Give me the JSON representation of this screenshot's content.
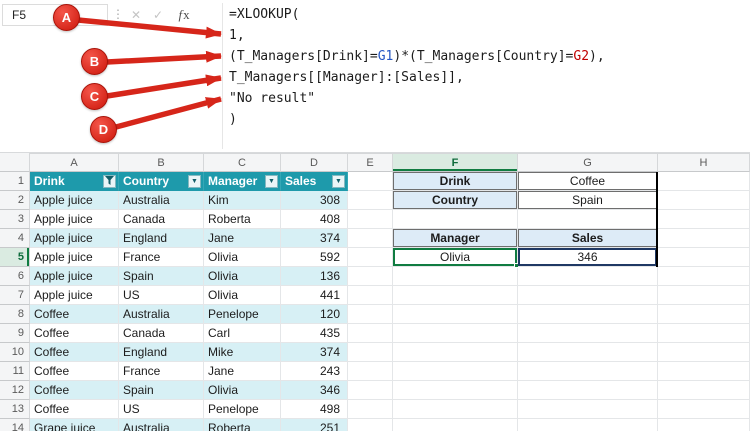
{
  "name_box": {
    "value": "F5"
  },
  "formula_bar": {
    "cancel": "✕",
    "enter": "✓",
    "fx": "fx",
    "lines": [
      [
        {
          "t": "=XLOOKUP(",
          "c": "d"
        }
      ],
      [
        {
          "t": "1,",
          "c": "d"
        }
      ],
      [
        {
          "t": "(T_Managers[Drink]=",
          "c": "d"
        },
        {
          "t": "G1",
          "c": "r1"
        },
        {
          "t": ")*(T_Managers[Country]=",
          "c": "d"
        },
        {
          "t": "G2",
          "c": "r2"
        },
        {
          "t": "),",
          "c": "d"
        }
      ],
      [
        {
          "t": "T_Managers[[Manager]:[Sales]],",
          "c": "d"
        }
      ],
      [
        {
          "t": "\"No result\"",
          "c": "d"
        }
      ],
      [
        {
          "t": ")",
          "c": "d"
        }
      ]
    ]
  },
  "callouts": [
    {
      "label": "A"
    },
    {
      "label": "B"
    },
    {
      "label": "C"
    },
    {
      "label": "D"
    }
  ],
  "grid": {
    "columns": [
      "A",
      "B",
      "C",
      "D",
      "E",
      "F",
      "G",
      "H"
    ],
    "rows": [
      "1",
      "2",
      "3",
      "4",
      "5",
      "6",
      "7",
      "8",
      "9",
      "10",
      "11",
      "12",
      "13",
      "14"
    ]
  },
  "table": {
    "name": "T_Managers",
    "headers": [
      {
        "label": "Drink",
        "filtered": true
      },
      {
        "label": "Country",
        "filtered": false
      },
      {
        "label": "Manager",
        "filtered": false
      },
      {
        "label": "Sales",
        "filtered": false
      }
    ],
    "rows": [
      [
        "Apple juice",
        "Australia",
        "Kim",
        "308"
      ],
      [
        "Apple juice",
        "Canada",
        "Roberta",
        "408"
      ],
      [
        "Apple juice",
        "England",
        "Jane",
        "374"
      ],
      [
        "Apple juice",
        "France",
        "Olivia",
        "592"
      ],
      [
        "Apple juice",
        "Spain",
        "Olivia",
        "136"
      ],
      [
        "Apple juice",
        "US",
        "Olivia",
        "441"
      ],
      [
        "Coffee",
        "Australia",
        "Penelope",
        "120"
      ],
      [
        "Coffee",
        "Canada",
        "Carl",
        "435"
      ],
      [
        "Coffee",
        "England",
        "Mike",
        "374"
      ],
      [
        "Coffee",
        "France",
        "Jane",
        "243"
      ],
      [
        "Coffee",
        "Spain",
        "Olivia",
        "346"
      ],
      [
        "Coffee",
        "US",
        "Penelope",
        "498"
      ],
      [
        "Grape juice",
        "Australia",
        "Roberta",
        "251"
      ]
    ]
  },
  "lookup_panel": {
    "drink_label": "Drink",
    "drink_value": "Coffee",
    "country_label": "Country",
    "country_value": "Spain",
    "manager_label": "Manager",
    "manager_value": "Olivia",
    "sales_label": "Sales",
    "sales_value": "346"
  },
  "colors": {
    "table_header_bg": "#1E9AAB",
    "band_bg": "#D7F0F5",
    "label_bg": "#DDEBF7",
    "active_cell_border": "#107C41",
    "result_cell_border": "#1F3864",
    "callout_red": "#D6261A",
    "ref1_color": "#2456C4",
    "ref2_color": "#C00000"
  }
}
